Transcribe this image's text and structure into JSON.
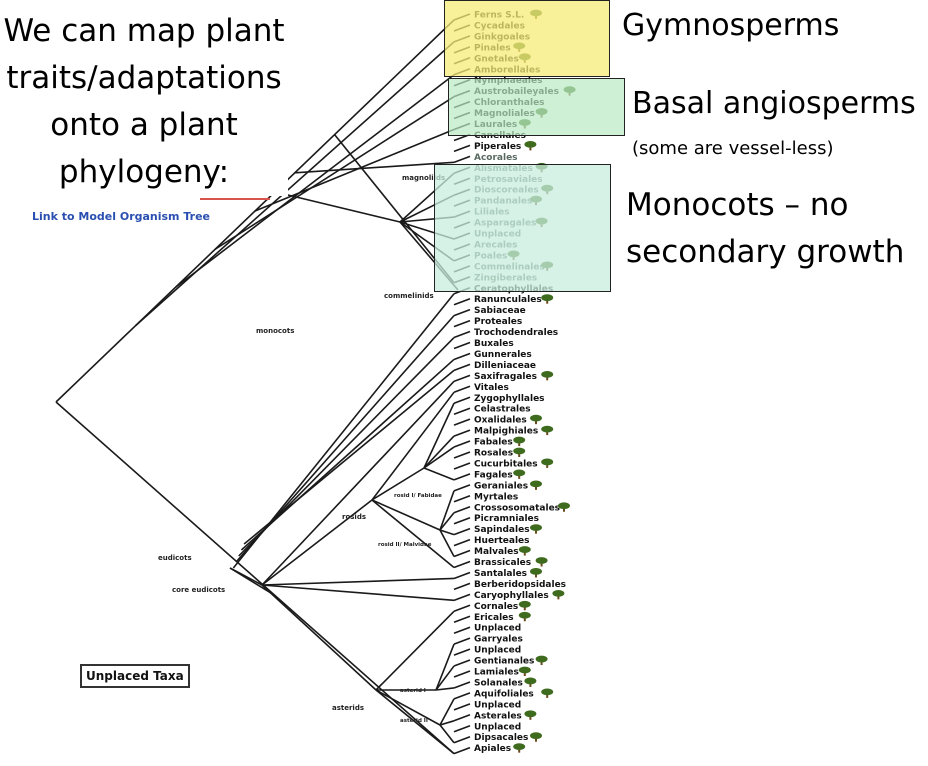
{
  "intro": {
    "line1": "We can map plant",
    "line2": "traits/adaptations",
    "line3": "onto a plant",
    "line4": "phylogeny:"
  },
  "link_label": "Link to Model Organism Tree",
  "callouts": {
    "gymnosperms": "Gymnosperms",
    "basal": "Basal angiosperms",
    "basal_note": "(some are vessel-less)",
    "monocots_line1": "Monocots – no",
    "monocots_line2": "secondary growth"
  },
  "unplaced_label": "Unplaced Taxa",
  "clade_labels": {
    "magnoliids": "magnoliids",
    "commelinids": "commelinids",
    "monocots": "monocots",
    "eudicots": "eudicots",
    "core_eudicots": "core eudicots",
    "rosids": "rosids",
    "rosid1": "rosid I/ Fabidae",
    "rosid2": "rosid II/ Malvidae",
    "asterids": "asterids",
    "asterid1": "asterid I",
    "asterid2": "asterid II"
  },
  "taxa": [
    {
      "name": "Ferns S.L.",
      "tree": true,
      "group": "gymno"
    },
    {
      "name": "Cycadales",
      "tree": false,
      "group": "gymno"
    },
    {
      "name": "Ginkgoales",
      "tree": false,
      "group": "gymno"
    },
    {
      "name": "Pinales",
      "tree": true,
      "group": "gymno"
    },
    {
      "name": "Gnetales",
      "tree": true,
      "group": "gymno"
    },
    {
      "name": "Amborellales",
      "tree": false,
      "group": "basal"
    },
    {
      "name": "Nymphaeales",
      "tree": false,
      "group": "basal"
    },
    {
      "name": "Austrobaileyales",
      "tree": true,
      "group": "basal"
    },
    {
      "name": "Chloranthales",
      "tree": false,
      "group": "basal"
    },
    {
      "name": "Magnoliales",
      "tree": true,
      "group": "basal"
    },
    {
      "name": "Laurales",
      "tree": true,
      "group": "other"
    },
    {
      "name": "Canellales",
      "tree": false,
      "group": "other"
    },
    {
      "name": "Piperales",
      "tree": true,
      "group": "other"
    },
    {
      "name": "Acorales",
      "tree": false,
      "group": "mono"
    },
    {
      "name": "Alismatales",
      "tree": true,
      "group": "mono"
    },
    {
      "name": "Petrosaviales",
      "tree": false,
      "group": "mono"
    },
    {
      "name": "Dioscoreales",
      "tree": true,
      "group": "mono"
    },
    {
      "name": "Pandanales",
      "tree": true,
      "group": "mono"
    },
    {
      "name": "Liliales",
      "tree": false,
      "group": "mono"
    },
    {
      "name": "Asparagales",
      "tree": true,
      "group": "mono"
    },
    {
      "name": "Unplaced",
      "tree": false,
      "group": "mono"
    },
    {
      "name": "Arecales",
      "tree": false,
      "group": "mono"
    },
    {
      "name": "Poales",
      "tree": true,
      "group": "mono"
    },
    {
      "name": "Commelinales",
      "tree": true,
      "group": "mono"
    },
    {
      "name": "Zingiberales",
      "tree": false,
      "group": "mono"
    },
    {
      "name": "Ceratophyllales",
      "tree": false,
      "group": "other"
    },
    {
      "name": "Ranunculales",
      "tree": true,
      "group": "other"
    },
    {
      "name": "Sabiaceae",
      "tree": false,
      "group": "other"
    },
    {
      "name": "Proteales",
      "tree": false,
      "group": "other"
    },
    {
      "name": "Trochodendrales",
      "tree": false,
      "group": "other"
    },
    {
      "name": "Buxales",
      "tree": false,
      "group": "other"
    },
    {
      "name": "Gunnerales",
      "tree": false,
      "group": "other"
    },
    {
      "name": "Dilleniaceae",
      "tree": false,
      "group": "other"
    },
    {
      "name": "Saxifragales",
      "tree": true,
      "group": "other"
    },
    {
      "name": "Vitales",
      "tree": false,
      "group": "other"
    },
    {
      "name": "Zygophyllales",
      "tree": false,
      "group": "other"
    },
    {
      "name": "Celastrales",
      "tree": false,
      "group": "other"
    },
    {
      "name": "Oxalidales",
      "tree": true,
      "group": "other"
    },
    {
      "name": "Malpighiales",
      "tree": true,
      "group": "other"
    },
    {
      "name": "Fabales",
      "tree": true,
      "group": "other"
    },
    {
      "name": "Rosales",
      "tree": true,
      "group": "other"
    },
    {
      "name": "Cucurbitales",
      "tree": true,
      "group": "other"
    },
    {
      "name": "Fagales",
      "tree": true,
      "group": "other"
    },
    {
      "name": "Geraniales",
      "tree": true,
      "group": "other"
    },
    {
      "name": "Myrtales",
      "tree": false,
      "group": "other"
    },
    {
      "name": "Crossosomatales",
      "tree": true,
      "group": "other"
    },
    {
      "name": "Picramniales",
      "tree": false,
      "group": "other"
    },
    {
      "name": "Sapindales",
      "tree": true,
      "group": "other"
    },
    {
      "name": "Huerteales",
      "tree": false,
      "group": "other"
    },
    {
      "name": "Malvales",
      "tree": true,
      "group": "other"
    },
    {
      "name": "Brassicales",
      "tree": true,
      "group": "other"
    },
    {
      "name": "Santalales",
      "tree": true,
      "group": "other"
    },
    {
      "name": "Berberidopsidales",
      "tree": false,
      "group": "other"
    },
    {
      "name": "Caryophyllales",
      "tree": true,
      "group": "other"
    },
    {
      "name": "Cornales",
      "tree": true,
      "group": "other"
    },
    {
      "name": "Ericales",
      "tree": true,
      "group": "other"
    },
    {
      "name": "Unplaced",
      "tree": false,
      "group": "other"
    },
    {
      "name": "Garryales",
      "tree": false,
      "group": "other"
    },
    {
      "name": "Unplaced",
      "tree": false,
      "group": "other"
    },
    {
      "name": "Gentianales",
      "tree": true,
      "group": "other"
    },
    {
      "name": "Lamiales",
      "tree": true,
      "group": "other"
    },
    {
      "name": "Solanales",
      "tree": true,
      "group": "other"
    },
    {
      "name": "Aquifoliales",
      "tree": true,
      "group": "other"
    },
    {
      "name": "Unplaced",
      "tree": false,
      "group": "other"
    },
    {
      "name": "Asterales",
      "tree": true,
      "group": "other"
    },
    {
      "name": "Unplaced",
      "tree": false,
      "group": "other"
    },
    {
      "name": "Dipsacales",
      "tree": true,
      "group": "other"
    },
    {
      "name": "Apiales",
      "tree": true,
      "group": "other"
    }
  ],
  "colors": {
    "gymno_box": "#f7eb78",
    "basal_box": "#b9ebc3",
    "mono_box": "#c8eede",
    "link": "#2a4fb0",
    "tree_icon": "#3f6b1f",
    "line": "#1a1a1a"
  }
}
